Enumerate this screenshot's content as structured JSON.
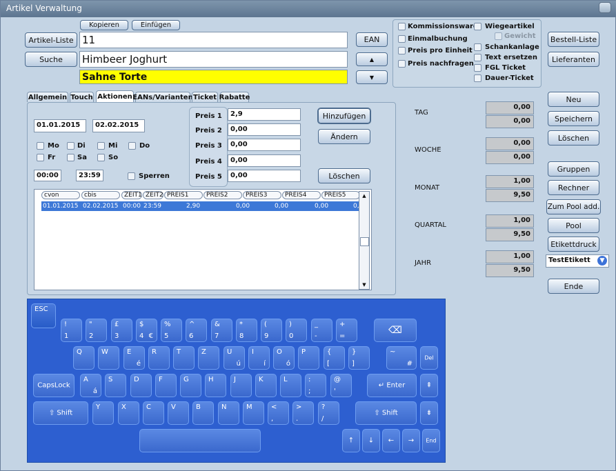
{
  "app": {
    "title": "Artikel Verwaltung"
  },
  "topbar": {
    "kopieren": "Kopieren",
    "einfuegen": "Einfügen",
    "artikel_liste": "Artikel-Liste",
    "suche": "Suche",
    "ean": "EAN",
    "up": "▲",
    "down": "▼"
  },
  "article": {
    "number": "11",
    "name": "Himbeer Joghurt",
    "group": "Sahne Torte"
  },
  "checks": {
    "kommission": "Kommissionsware",
    "einmal": "Einmalbuchung",
    "preis_einheit": "Preis pro Einheit",
    "preis_nachfragen": "Preis nachfragen",
    "wiege": "Wiegeartikel",
    "gewicht": "Gewicht",
    "schank": "Schankanlage",
    "text_ersetzen": "Text ersetzen",
    "fgl": "FGL Ticket",
    "dauer": "Dauer-Ticket"
  },
  "rightButtons": {
    "bestell": "Bestell-Liste",
    "lieferanten": "Lieferanten",
    "neu": "Neu",
    "speichern": "Speichern",
    "loeschen": "Löschen",
    "gruppen": "Gruppen",
    "rechner": "Rechner",
    "zum_pool": "Zum Pool add.",
    "pool": "Pool",
    "etikett": "Etikettdruck",
    "ende": "Ende"
  },
  "etikett_select": "TestEtikett",
  "tabs": [
    "Allgemein",
    "Touch",
    "Aktionen",
    "EANs/Varianten",
    "Ticket",
    "Rabatte"
  ],
  "aktion": {
    "from": "01.01.2015",
    "to": "02.02.2015",
    "time_from": "00:00",
    "time_to": "23:59",
    "days": {
      "mo": "Mo",
      "di": "Di",
      "mi": "Mi",
      "do": "Do",
      "fr": "Fr",
      "sa": "Sa",
      "so": "So"
    },
    "sperren": "Sperren",
    "prices": [
      {
        "label": "Preis 1",
        "value": "2,9"
      },
      {
        "label": "Preis 2",
        "value": "0,00"
      },
      {
        "label": "Preis 3",
        "value": "0,00"
      },
      {
        "label": "Preis 4",
        "value": "0,00"
      },
      {
        "label": "Preis 5",
        "value": "0,00"
      }
    ],
    "btn_add": "Hinzufügen",
    "btn_change": "Ändern",
    "btn_delete": "Löschen"
  },
  "grid": {
    "headers": [
      "cvon",
      "cbis",
      "ZEIT1",
      "ZEIT2",
      "PREIS1",
      "PREIS2",
      "PREIS3",
      "PREIS4",
      "PREIS5"
    ],
    "row": [
      "01.01.2015",
      "02.02.2015",
      "00:00",
      "23:59",
      "2,90",
      "0,00",
      "0,00",
      "0,00",
      "0,00"
    ]
  },
  "stats": {
    "tag": "TAG",
    "woche": "WOCHE",
    "monat": "MONAT",
    "quartal": "QUARTAL",
    "jahr": "JAHR",
    "values": {
      "tag": [
        "0,00",
        "0,00"
      ],
      "woche": [
        "0,00",
        "0,00"
      ],
      "monat": [
        "1,00",
        "9,50"
      ],
      "quartal": [
        "1,00",
        "9,50"
      ],
      "jahr": [
        "1,00",
        "9,50"
      ]
    }
  },
  "keyboard": {
    "esc": "ESC",
    "del": "Del",
    "caps": "CapsLock",
    "enter": "Enter",
    "shift": "Shift",
    "end": "End",
    "up": "↑",
    "down": "↓",
    "left": "←",
    "right": "→",
    "backspace": "⌫"
  }
}
